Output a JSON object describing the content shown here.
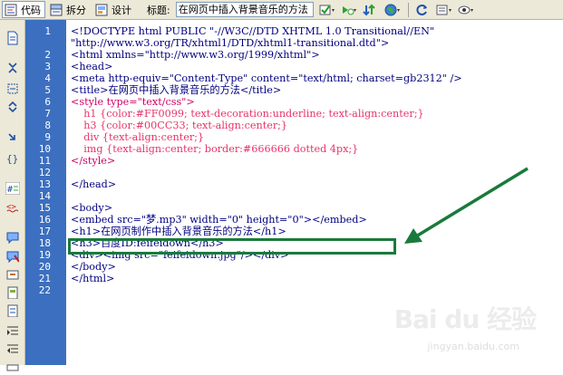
{
  "toolbar": {
    "code_label": "代码",
    "split_label": "拆分",
    "design_label": "设计",
    "title_label": "标题:",
    "title_value": "在网页中插入背景音乐的方法"
  },
  "gutter": {
    "lines": [
      "1",
      "2",
      "3",
      "4",
      "5",
      "6",
      "7",
      "8",
      "9",
      "10",
      "11",
      "12",
      "13",
      "14",
      "15",
      "16",
      "17",
      "18",
      "19",
      "20",
      "21",
      "22"
    ]
  },
  "code": {
    "l1": "<!DOCTYPE html PUBLIC \"-//W3C//DTD XHTML 1.0 Transitional//EN\"",
    "l1b": "\"http://www.w3.org/TR/xhtml1/DTD/xhtml1-transitional.dtd\">",
    "l2": "<html xmlns=\"http://www.w3.org/1999/xhtml\">",
    "l3": "<head>",
    "l4": "<meta http-equiv=\"Content-Type\" content=\"text/html; charset=gb2312\" />",
    "l5": "<title>在网页中插入背景音乐的方法</title>",
    "l6": "<style type=\"text/css\">",
    "l7": "    h1 {color:#FF0099; text-decoration:underline; text-align:center;}",
    "l8": "    h3 {color:#00CC33; text-align:center;}",
    "l9": "    div {text-align:center;}",
    "l10": "    img {text-align:center; border:#666666 dotted 4px;}",
    "l11": "</style>",
    "l12": "",
    "l13": "</head>",
    "l14": "",
    "l15": "<body>",
    "l16": "<embed src=\"梦.mp3\" width=\"0\" height=\"0\"></embed>",
    "l17": "<h1>在网页制作中插入背景音乐的方法</h1>",
    "l18": "<h3>百度ID:feifeidown</h3>",
    "l19": "<div><img src=\"feifeidown.jpg\"/></div>",
    "l20": "</body>",
    "l21": "</html>",
    "l22": ""
  },
  "watermark": {
    "brand": "Bai du 经验",
    "sub": "jingyan.baidu.com"
  },
  "colors": {
    "gutter": "#3c6fbf",
    "highlight": "#1a7a3c",
    "arrow": "#1a7a3c",
    "tag": "#000080",
    "css_selector": "#e8336a"
  }
}
